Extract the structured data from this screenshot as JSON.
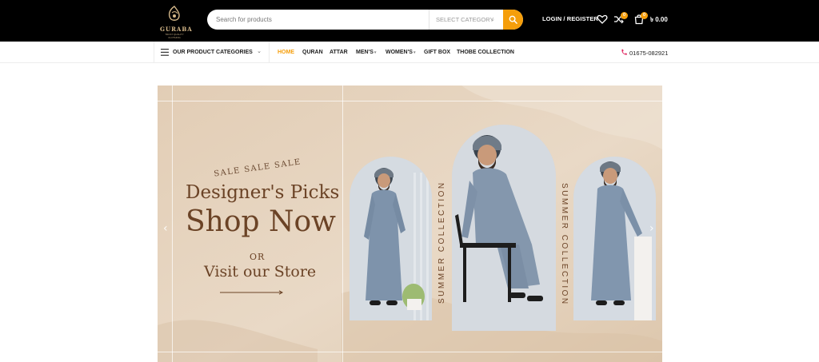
{
  "brand": {
    "name": "GURABA",
    "tagline": "TRUST QUALITY CLOTHING"
  },
  "header": {
    "search_placeholder": "Search for products",
    "category_select": "SELECT CATEGORY",
    "login_label": "LOGIN / REGISTER",
    "compare_count": "0",
    "cart_count": "0",
    "cart_total": "৳ 0.00",
    "accent_color": "#f59e0b"
  },
  "nav": {
    "categories_label": "OUR PRODUCT CATEGORIES",
    "items": [
      {
        "label": "HOME",
        "active": true,
        "dropdown": false
      },
      {
        "label": "QURAN",
        "active": false,
        "dropdown": false
      },
      {
        "label": "ATTAR",
        "active": false,
        "dropdown": false
      },
      {
        "label": "MEN'S",
        "active": false,
        "dropdown": true
      },
      {
        "label": "WOMEN'S",
        "active": false,
        "dropdown": true
      },
      {
        "label": "GIFT BOX",
        "active": false,
        "dropdown": false
      },
      {
        "label": "THOBE COLLECTION",
        "active": false,
        "dropdown": false
      }
    ],
    "phone": "01675-082921"
  },
  "hero": {
    "sale_line": "SALE SALE SALE",
    "headline_1": "Designer's Picks",
    "headline_2": "Shop Now",
    "or_text": "OR",
    "cta": "Visit our Store",
    "side_label_left": "SUMMER COLLECTION",
    "side_label_right": "SUMMER COLLECTION",
    "prev_icon": "chevron-left-icon",
    "next_icon": "chevron-right-icon"
  }
}
